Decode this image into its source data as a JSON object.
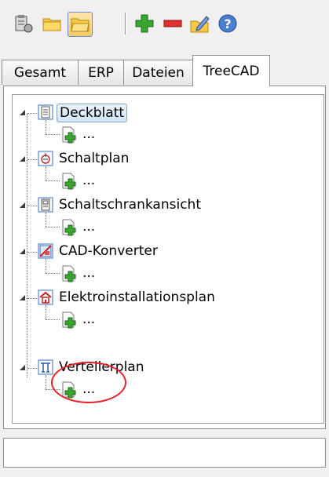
{
  "toolbar": {
    "buttons": [
      {
        "name": "properties-icon"
      },
      {
        "name": "open-folder-icon"
      },
      {
        "name": "folder-active-icon"
      },
      {
        "name": "add-icon"
      },
      {
        "name": "remove-icon"
      },
      {
        "name": "edit-icon"
      },
      {
        "name": "help-icon"
      }
    ]
  },
  "tabs": [
    {
      "label": "Gesamt"
    },
    {
      "label": "ERP"
    },
    {
      "label": "Dateien"
    },
    {
      "label": "TreeCAD",
      "active": true
    }
  ],
  "tree": {
    "nodes": [
      {
        "label": "Deckblatt",
        "icon": "document-icon",
        "selected": true,
        "child_label": "..."
      },
      {
        "label": "Schaltplan",
        "icon": "schematic-icon",
        "child_label": "..."
      },
      {
        "label": "Schaltschrankansicht",
        "icon": "cabinet-icon",
        "child_label": "..."
      },
      {
        "label": "CAD-Konverter",
        "icon": "cad-converter-icon",
        "child_label": "..."
      },
      {
        "label": "Elektroinstallationsplan",
        "icon": "house-icon",
        "child_label": "..."
      },
      {
        "label": "Verteilerplan",
        "icon": "distribution-icon",
        "child_label": "..."
      }
    ]
  },
  "colors": {
    "highlight": "#e8202a",
    "selection_border": "#7da2ce",
    "add_green": "#3aa630",
    "remove_red": "#e03030"
  }
}
